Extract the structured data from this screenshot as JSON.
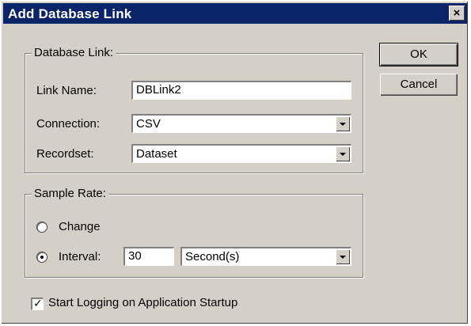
{
  "window": {
    "title": "Add Database Link",
    "close_glyph": "×"
  },
  "buttons": {
    "ok": "OK",
    "cancel": "Cancel"
  },
  "database_link": {
    "legend": "Database Link:",
    "link_name_label": "Link Name:",
    "link_name_value": "DBLink2",
    "connection_label": "Connection:",
    "connection_value": "CSV",
    "recordset_label": "Recordset:",
    "recordset_value": "Dataset"
  },
  "sample_rate": {
    "legend": "Sample Rate:",
    "change_label": "Change",
    "interval_label": "Interval:",
    "interval_value": "30",
    "unit_value": "Second(s)",
    "selected": "interval"
  },
  "start_logging": {
    "label": "Start Logging on Application Startup",
    "checked": true
  },
  "icons": {
    "close": "close-icon",
    "dropdown": "chevron-down-icon",
    "checkbox_mark": "checkmark-icon"
  },
  "colors": {
    "titlebar": "#0a246a",
    "face": "#d4d0c8"
  }
}
